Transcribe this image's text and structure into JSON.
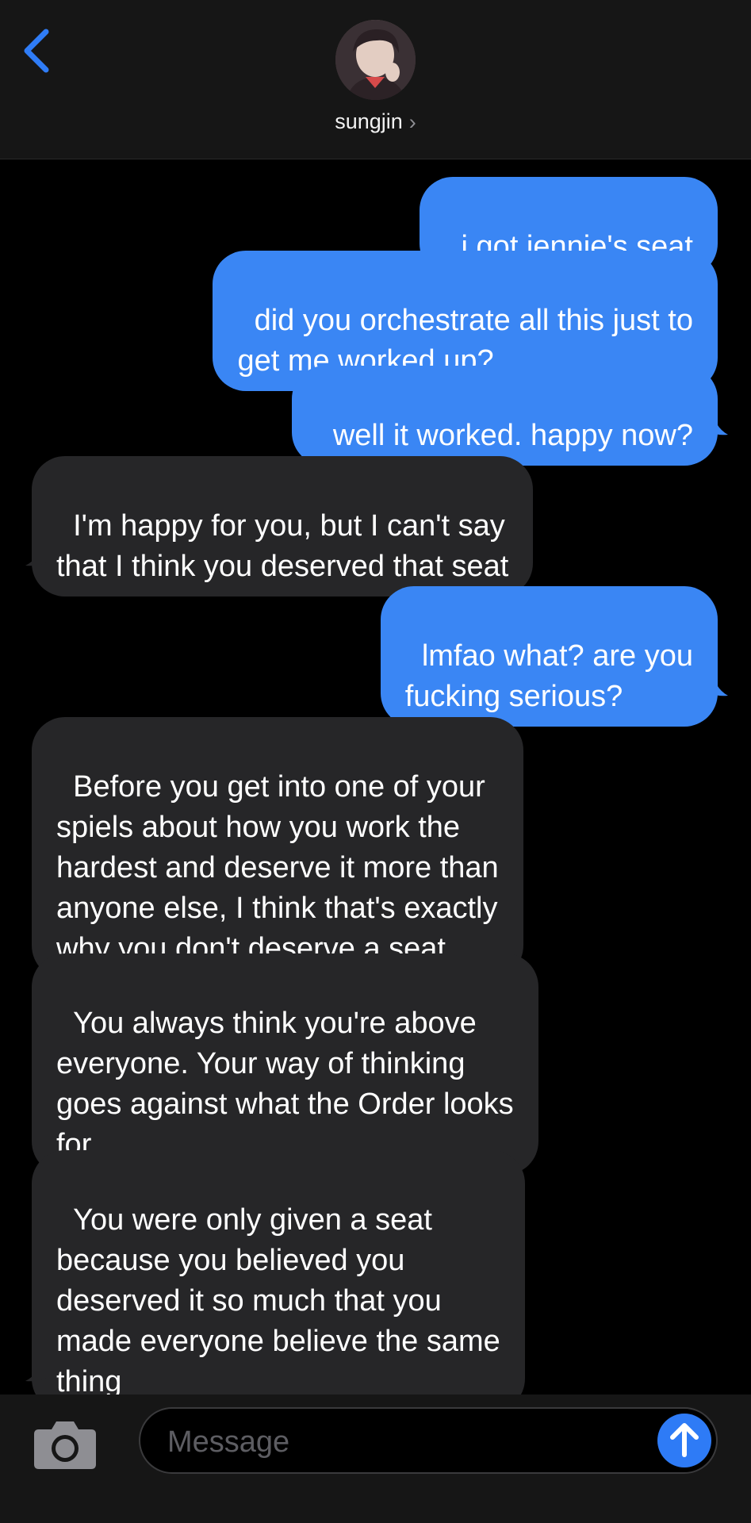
{
  "header": {
    "contact_name": "sungjin",
    "chevron": "›",
    "back_icon": "chevron-left-icon",
    "accent": "#2f7cf6"
  },
  "messages": [
    {
      "side": "sent",
      "text": "i got jennie's seat"
    },
    {
      "side": "sent",
      "text": "did you orchestrate all this just to\nget me worked up?"
    },
    {
      "side": "sent",
      "text": "well it worked. happy now?"
    },
    {
      "side": "received",
      "text": "I'm happy for you, but I can't say\nthat I think you deserved that seat"
    },
    {
      "side": "sent",
      "text": "lmfao what? are you\nfucking serious?"
    },
    {
      "side": "received",
      "text": "Before you get into one of your\nspiels about how you work the\nhardest and deserve it more than\nanyone else, I think that's exactly\nwhy you don't deserve a seat"
    },
    {
      "side": "received",
      "text": "You always think you're above\neveryone. Your way of thinking\ngoes against what the Order looks\nfor"
    },
    {
      "side": "received",
      "text": "You were only given a seat\nbecause you believed you\ndeserved it so much that you\nmade everyone believe the same\nthing"
    }
  ],
  "composer": {
    "placeholder": "Message",
    "camera_icon": "camera-icon",
    "send_icon": "arrow-up-icon"
  },
  "colors": {
    "sent_bubble": "#3a86f4",
    "received_bubble": "#262628",
    "background": "#000000",
    "bar": "#161616"
  }
}
